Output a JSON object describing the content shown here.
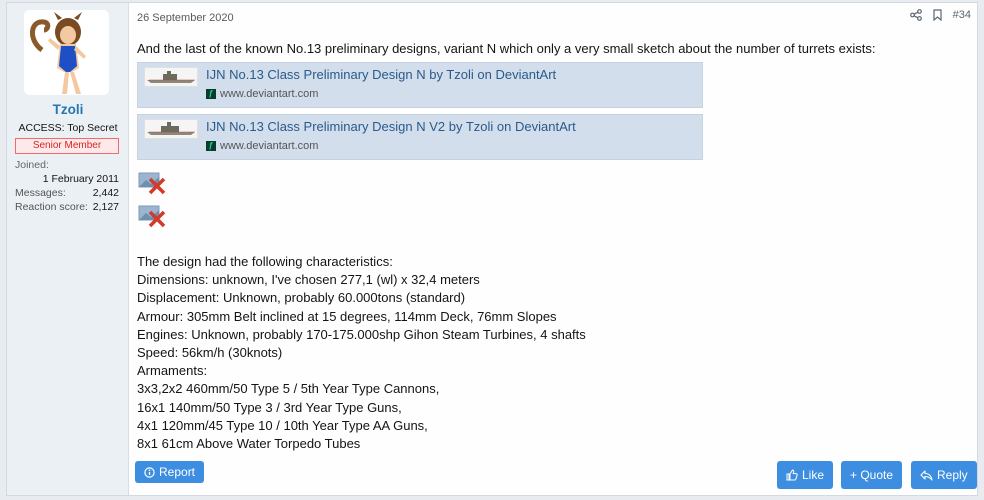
{
  "user": {
    "name": "Tzoli",
    "title": "ACCESS: Top Secret",
    "banner": "Senior Member",
    "joined_label": "Joined:",
    "joined_value": "1 February 2011",
    "messages_label": "Messages:",
    "messages_value": "2,442",
    "reaction_label": "Reaction score:",
    "reaction_value": "2,127"
  },
  "post": {
    "date": "26 September 2020",
    "number": "#34",
    "intro": "And the last of the known No.13 preliminary designs, variant N which only a very small sketch about the number of turrets exists:",
    "embeds": [
      {
        "title": "IJN No.13 Class Preliminary Design N by Tzoli on DeviantArt",
        "site": "www.deviantart.com"
      },
      {
        "title": "IJN No.13 Class Preliminary Design N V2 by Tzoli on DeviantArt",
        "site": "www.deviantart.com"
      }
    ],
    "lines": [
      "The design had the following characteristics:",
      "Dimensions: unknown, I've chosen 277,1 (wl) x 32,4 meters",
      "Displacement: Unknown, probably 60.000tons (standard)",
      "Armour: 305mm Belt inclined at 15 degrees, 114mm Deck, 76mm Slopes",
      "Engines: Unknown, probably 170-175.000shp Gihon Steam Turbines, 4 shafts",
      "Speed: 56km/h (30knots)",
      "Armaments:",
      "3x3,2x2 460mm/50 Type 5 / 5th Year Type Cannons,",
      "16x1 140mm/50 Type 3 / 3rd Year Type Guns,",
      "4x1 120mm/45 Type 10 / 10th Year Type AA Guns,",
      "8x1 61cm Above Water Torpedo Tubes"
    ]
  },
  "actions": {
    "report": "Report",
    "like": "Like",
    "quote": "+ Quote",
    "reply": "Reply"
  },
  "colors": {
    "accent": "#3d8ee0",
    "username": "#2577b1",
    "banner_border": "#f06b6b",
    "embed_bg": "#d3deec"
  }
}
